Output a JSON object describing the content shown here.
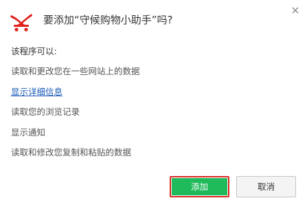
{
  "dialog": {
    "title": "要添加“守候购物小助手”吗?",
    "extension_icon": "cart-logo-icon",
    "brand_color": "#e0211b",
    "close_icon": "close-icon"
  },
  "permissions": {
    "heading": "该程序可以:",
    "items": [
      "读取和更改您在一些网站上的数据",
      "显示详细信息",
      "读取您的浏览记录",
      "显示通知",
      "读取和修改您复制和粘贴的数据"
    ]
  },
  "buttons": {
    "add_label": "添加",
    "cancel_label": "取消",
    "add_color": "#1fba5a",
    "highlight_color": "#d9261c"
  }
}
